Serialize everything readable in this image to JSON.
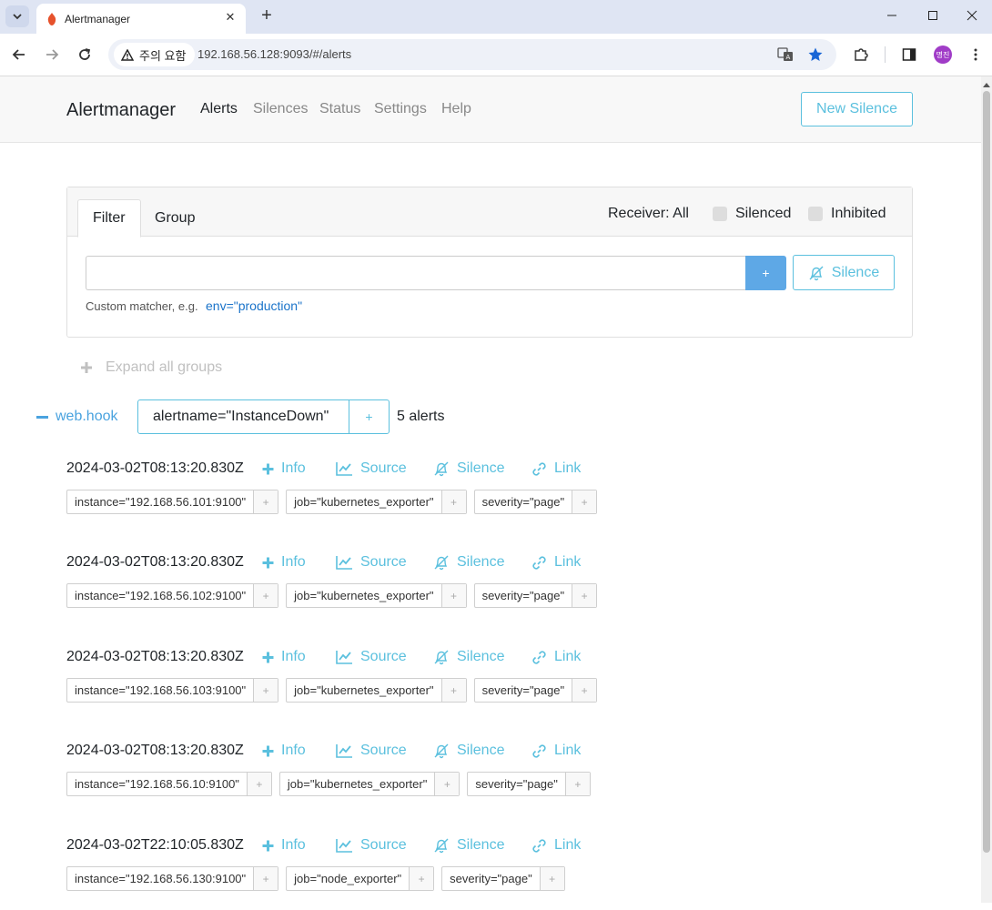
{
  "browser": {
    "tab_title": "Alertmanager",
    "security_label": "주의 요함",
    "url": "192.168.56.128:9093/#/alerts",
    "avatar_text": "명진"
  },
  "navbar": {
    "brand": "Alertmanager",
    "links": [
      "Alerts",
      "Silences",
      "Status",
      "Settings",
      "Help"
    ],
    "active": "Alerts",
    "new_silence": "New Silence"
  },
  "filter": {
    "tabs": [
      "Filter",
      "Group"
    ],
    "receiver": "Receiver: All",
    "silenced_label": "Silenced",
    "inhibited_label": "Inhibited",
    "input_value": "",
    "add_label": "+",
    "silence_label": "Silence",
    "hint": "Custom matcher, e.g.",
    "hint_example": "env=\"production\""
  },
  "expand_all": "Expand all groups",
  "group": {
    "receiver": "web.hook",
    "label": "alertname=\"InstanceDown\"",
    "plus": "+",
    "count": "5 alerts"
  },
  "alert_actions": {
    "info": "Info",
    "source": "Source",
    "silence": "Silence",
    "link": "Link"
  },
  "alerts": [
    {
      "timestamp": "2024-03-02T08:13:20.830Z",
      "labels": [
        "instance=\"192.168.56.101:9100\"",
        "job=\"kubernetes_exporter\"",
        "severity=\"page\""
      ]
    },
    {
      "timestamp": "2024-03-02T08:13:20.830Z",
      "labels": [
        "instance=\"192.168.56.102:9100\"",
        "job=\"kubernetes_exporter\"",
        "severity=\"page\""
      ]
    },
    {
      "timestamp": "2024-03-02T08:13:20.830Z",
      "labels": [
        "instance=\"192.168.56.103:9100\"",
        "job=\"kubernetes_exporter\"",
        "severity=\"page\""
      ]
    },
    {
      "timestamp": "2024-03-02T08:13:20.830Z",
      "labels": [
        "instance=\"192.168.56.10:9100\"",
        "job=\"kubernetes_exporter\"",
        "severity=\"page\""
      ]
    },
    {
      "timestamp": "2024-03-02T22:10:05.830Z",
      "labels": [
        "instance=\"192.168.56.130:9100\"",
        "job=\"node_exporter\"",
        "severity=\"page\""
      ]
    }
  ],
  "colors": {
    "accent": "#5bc0de",
    "primary": "#5ea8e6",
    "link": "#1a73c9"
  }
}
